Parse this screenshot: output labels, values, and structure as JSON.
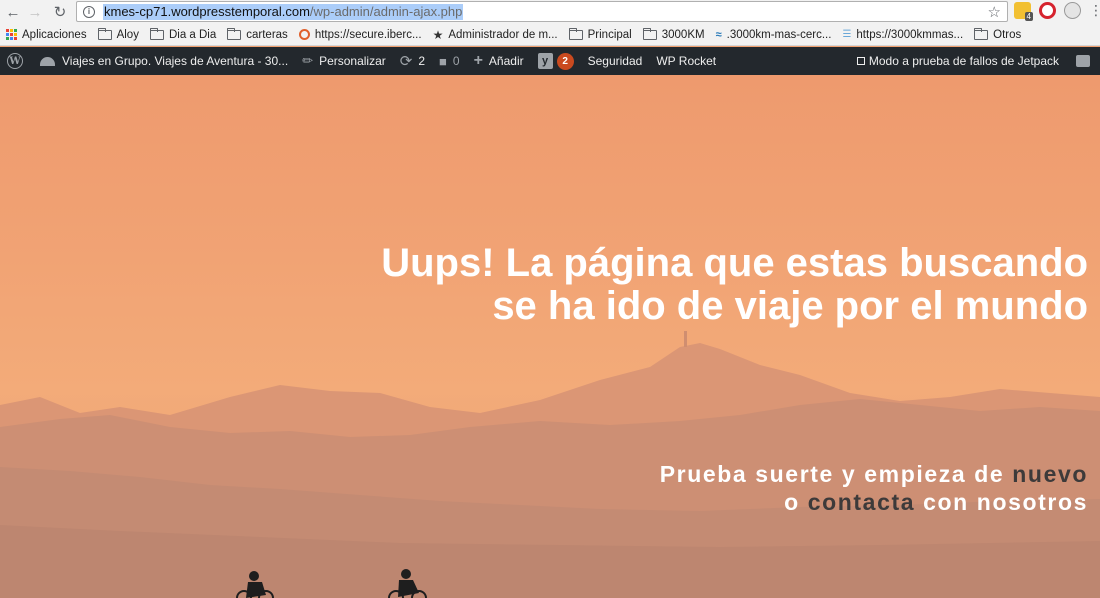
{
  "browser": {
    "url_host": "kmes-cp71.wordpresstemporal.com",
    "url_path": "/wp-admin/admin-ajax.php",
    "mail_badge": "4"
  },
  "bookmarks": [
    {
      "label": "Aplicaciones",
      "icon": "apps-grid-icon"
    },
    {
      "label": "Aloy",
      "icon": "folder-icon"
    },
    {
      "label": "Dia a Dia",
      "icon": "folder-icon"
    },
    {
      "label": "carteras",
      "icon": "folder-icon"
    },
    {
      "label": "https://secure.iberc...",
      "icon": "target-icon"
    },
    {
      "label": "Administrador de m...",
      "icon": "star-icon"
    },
    {
      "label": "Principal",
      "icon": "folder-icon"
    },
    {
      "label": "3000KM",
      "icon": "folder-icon"
    },
    {
      "label": ".3000km-mas-cerc...",
      "icon": "wifi-icon"
    },
    {
      "label": "https://3000kmmas...",
      "icon": "site-icon"
    },
    {
      "label": "Otros",
      "icon": "folder-icon"
    }
  ],
  "admin_bar": {
    "site_name": "Viajes en Grupo. Viajes de Aventura - 30...",
    "customize": "Personalizar",
    "updates_count": "2",
    "comments_count": "0",
    "new_label": "Añadir",
    "yoast_count": "2",
    "security": "Seguridad",
    "wp_rocket": "WP Rocket",
    "jetpack_debug": "Modo a prueba de fallos de Jetpack"
  },
  "hero": {
    "title_line1": "Uups! La página que estas buscando",
    "title_line2": "se ha ido de viaje por el mundo",
    "sub_line1_prefix": "Prueba suerte y empieza de ",
    "sub_line1_link": "nuevo",
    "sub_line2_prefix": "o ",
    "sub_line2_link": "contacta",
    "sub_line2_suffix": " con nosotros"
  },
  "colors": {
    "admin_bar_bg": "#23282d",
    "sky": "#f1a374",
    "badge": "#ca4a1f",
    "dark_link": "#3d3a3a"
  }
}
